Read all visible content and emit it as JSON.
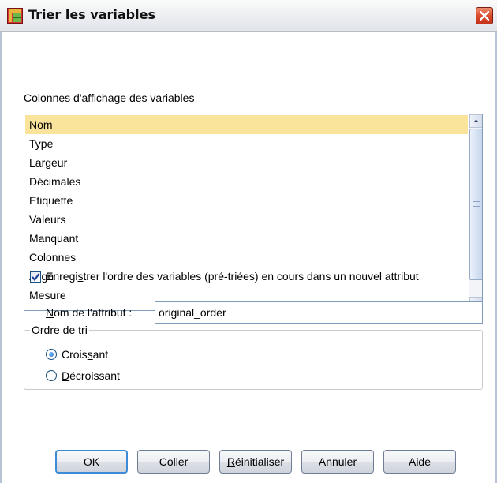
{
  "window": {
    "title": "Trier les variables",
    "accent_color": "#3d8bd6"
  },
  "columns_label": {
    "before": "Colonnes d'affichage des ",
    "mnemonic": "v",
    "after": "ariables"
  },
  "list": {
    "selected_index": 0,
    "selected_color": "#fae49c",
    "items": [
      "Nom",
      "Type",
      "Largeur",
      "Décimales",
      "Etiquette",
      "Valeurs",
      "Manquant",
      "Colonnes",
      "Align",
      "Mesure"
    ]
  },
  "sort_order": {
    "title": "Ordre de tri",
    "options": [
      {
        "before": "Crois",
        "mnemonic": "s",
        "after": "ant",
        "selected": true
      },
      {
        "before": "",
        "mnemonic": "D",
        "after": "écroissant",
        "selected": false
      }
    ]
  },
  "save_order": {
    "checked": true,
    "before": "Enregi",
    "mnemonic": "s",
    "after": "trer l'ordre des variables (pré-triées) en cours dans un nouvel attribut"
  },
  "attribute": {
    "label_mnemonic": "N",
    "label_rest": "om de l'attribut :",
    "value": "original_order"
  },
  "buttons": {
    "ok": "OK",
    "paste": "Coller",
    "reset_mnemonic": "R",
    "reset_rest": "éinitialiser",
    "cancel": "Annuler",
    "help": "Aide"
  },
  "icons": {
    "title": "data-grid-icon",
    "close": "close-icon",
    "scroll_up": "arrow-up-icon",
    "scroll_down": "arrow-down-icon",
    "radio_selected": "radio-selected-icon",
    "radio_unselected": "radio-unselected-icon",
    "checkbox": "checkmark-icon"
  }
}
